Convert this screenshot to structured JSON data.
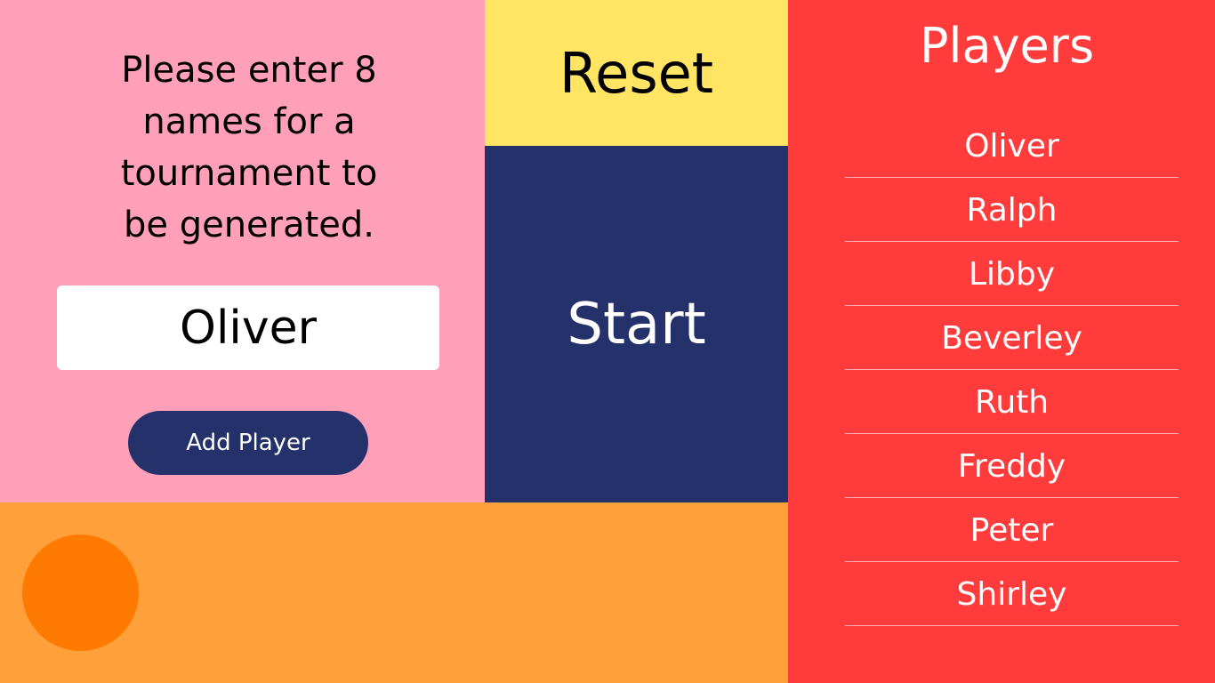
{
  "colors": {
    "input_panel_bg": "#ffa0b8",
    "reset_bg": "#ffe563",
    "start_bg": "#24316b",
    "add_button_bg": "#24316b",
    "bottom_bar_bg": "#ffa03a",
    "circle": "#ff7a00",
    "players_panel_bg": "#ff3b3b"
  },
  "input_panel": {
    "instructions": "Please enter 8 names for a tournament to be generated.",
    "name_input_value": "Oliver",
    "add_button_label": "Add Player"
  },
  "controls": {
    "reset_label": "Reset",
    "start_label": "Start"
  },
  "players": {
    "title": "Players",
    "items": [
      {
        "name": "Oliver"
      },
      {
        "name": "Ralph"
      },
      {
        "name": "Libby"
      },
      {
        "name": "Beverley"
      },
      {
        "name": "Ruth"
      },
      {
        "name": "Freddy"
      },
      {
        "name": "Peter"
      },
      {
        "name": "Shirley"
      }
    ]
  }
}
